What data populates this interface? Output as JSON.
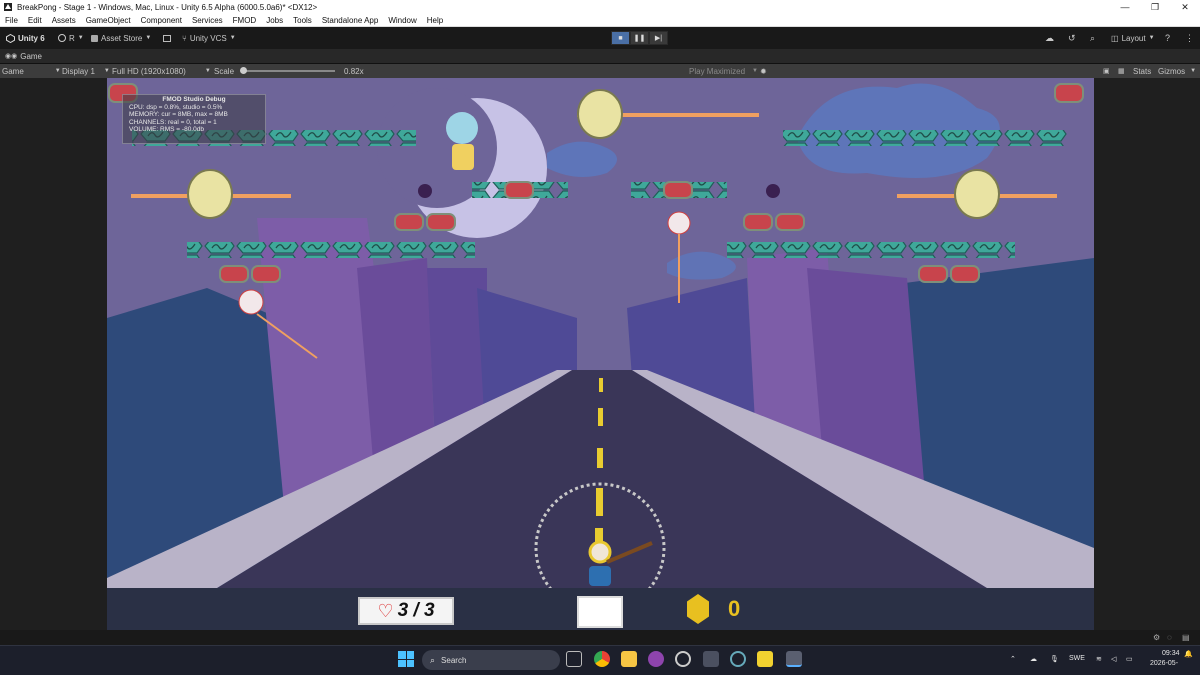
{
  "window": {
    "title": "BreakPong - Stage 1 - Windows, Mac, Linux - Unity 6.5 Alpha (6000.5.0a6)* <DX12>",
    "min": "—",
    "max": "❐",
    "close": "✕"
  },
  "menu": [
    "File",
    "Edit",
    "Assets",
    "GameObject",
    "Component",
    "Services",
    "FMOD",
    "Jobs",
    "Tools",
    "Standalone App",
    "Window",
    "Help"
  ],
  "toolbar": {
    "unity": "Unity 6",
    "account": "R",
    "asset_store": "Asset Store",
    "vcs": "Unity VCS",
    "layout": "Layout"
  },
  "tab": {
    "label": "Game"
  },
  "game_bar": {
    "mode": "Game",
    "display": "Display 1",
    "resolution": "Full HD (1920x1080)",
    "scale_label": "Scale",
    "scale_value": "0.82x",
    "play_mode": "Play Maximized",
    "stats": "Stats",
    "gizmos": "Gizmos"
  },
  "fmod": {
    "title": "FMOD Studio Debug",
    "cpu": "CPU: dsp = 0.8%, studio = 0.5%",
    "memory": "MEMORY: cur = 8MB, max = 8MB",
    "channels": "CHANNELS: real = 0, total = 1",
    "volume": "VOLUME: RMS = -80.0db"
  },
  "hud": {
    "lives": "3 / 3",
    "coins": "0"
  },
  "taskbar": {
    "search": "Search",
    "lang": "SWE",
    "time": "09:34",
    "date": "2026-05-"
  },
  "colors": {
    "sky": "#6e6599",
    "road": "#3a3658",
    "block_teal": "#3fa89a",
    "block_red": "#c8444c",
    "hp_bar": "#f0a060"
  }
}
